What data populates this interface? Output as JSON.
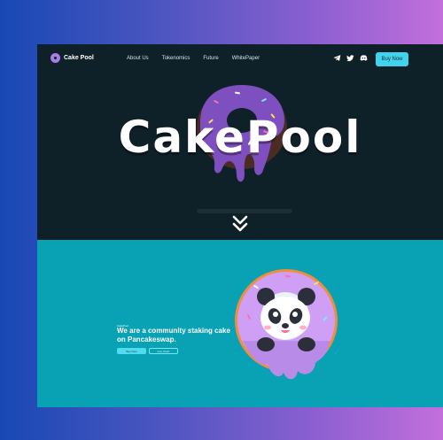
{
  "nav": {
    "logo_text": "Cake Pool",
    "links": [
      "About Us",
      "Tokenomics",
      "Future",
      "WhitePaper"
    ],
    "buy_label": "Buy Now",
    "socials": [
      "telegram-icon",
      "twitter-icon",
      "discord-icon"
    ]
  },
  "hero": {
    "title": "CakePool"
  },
  "about": {
    "small_label": "CakePool",
    "tagline": "We are a community staking cake on Pancakeswap.",
    "primary_button": "Buy Now",
    "secondary_button": "Live Chart"
  },
  "colors": {
    "hero_bg": "#0e2128",
    "section_bg": "#08a2b4",
    "accent": "#41d2ec",
    "donut_icing": "#7e4fbe"
  }
}
